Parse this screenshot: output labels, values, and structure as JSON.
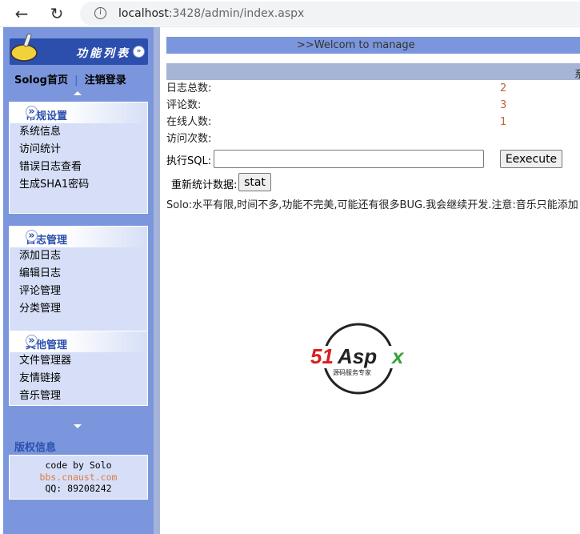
{
  "browser": {
    "url_host": "localhost",
    "url_rest": ":3428/admin/index.aspx"
  },
  "sidebar": {
    "header_title": "功能列表",
    "home_link": "Solog首页",
    "separator": "|",
    "logout_link": "注销登录",
    "sections": [
      {
        "title": "常规设置",
        "items": [
          "系统信息",
          "访问统计",
          "错误日志查看",
          "生成SHA1密码"
        ]
      },
      {
        "title": "日志管理",
        "items": [
          "添加日志",
          "编辑日志",
          "评论管理",
          "分类管理"
        ]
      },
      {
        "title": "其他管理",
        "items": [
          "文件管理器",
          "友情链接",
          "音乐管理"
        ]
      }
    ],
    "copyright_title": "版权信息",
    "copyright": {
      "line1": "code by Solo",
      "link": "bbs.cnaust.com",
      "qq": "QQ: 89208242"
    }
  },
  "main": {
    "welcome": ">>Welcom to manage",
    "section_header": "系",
    "stats": [
      {
        "label": "日志总数:",
        "value": "2"
      },
      {
        "label": "评论数:",
        "value": "3"
      },
      {
        "label": "在线人数:",
        "value": "1"
      },
      {
        "label": "访问次数:",
        "value": ""
      }
    ],
    "sql_label": "执行SQL:",
    "sql_value": "",
    "execute_button": "Eexecute",
    "stat_label": "重新统计数据:",
    "stat_button": "stat",
    "note": "Solo:水平有限,时间不多,功能不完美,可能还有很多BUG.我会继续开发.注意:音乐只能添加"
  },
  "watermark": {
    "logo_text": "51Aspx",
    "tagline": "源码服务专家"
  }
}
